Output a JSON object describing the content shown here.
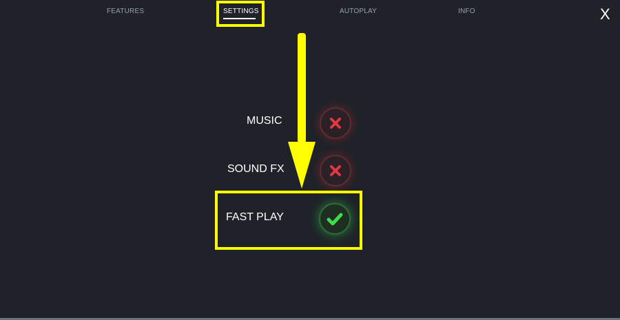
{
  "tabs": [
    {
      "id": "features",
      "label": "FEATURES",
      "active": false
    },
    {
      "id": "settings",
      "label": "SETTINGS",
      "active": true
    },
    {
      "id": "autoplay",
      "label": "AUTOPLAY",
      "active": false
    },
    {
      "id": "info",
      "label": "INFO",
      "active": false
    }
  ],
  "close_label": "X",
  "settings": [
    {
      "id": "music",
      "label": "MUSIC",
      "enabled": false,
      "icon": "x-icon"
    },
    {
      "id": "sound_fx",
      "label": "SOUND FX",
      "enabled": false,
      "icon": "x-icon"
    },
    {
      "id": "fast_play",
      "label": "FAST PLAY",
      "enabled": true,
      "icon": "check-icon"
    }
  ],
  "colors": {
    "background": "#1f2329",
    "highlight": "#ffff00",
    "off": "#e0393f",
    "on": "#3fdc4a",
    "tab_inactive": "#9aa0a8"
  },
  "annotation": {
    "highlight_color": "#ffff00",
    "arrow_direction": "down"
  }
}
